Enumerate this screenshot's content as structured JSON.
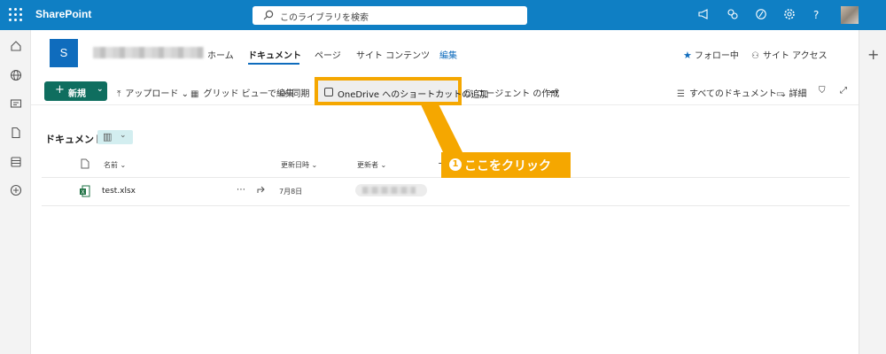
{
  "suitebar": {
    "brand": "SharePoint",
    "search_placeholder": "このライブラリを検索",
    "help": "?"
  },
  "site": {
    "logo_letter": "S",
    "nav": [
      "ホーム",
      "ドキュメント",
      "ページ",
      "サイト コンテンツ",
      "編集"
    ],
    "follow": "フォロー中",
    "access": "サイト アクセス"
  },
  "commandbar": {
    "new": "新規",
    "upload": "アップロード",
    "grid_edit": "グリッド ビューで編集",
    "sync": "同期",
    "onedrive_shortcut": "OneDrive へのショートカットの追加",
    "create_agent": "エージェント の作成",
    "more": "…",
    "all_docs": "すべてのドキュメント",
    "details": "詳細"
  },
  "library": {
    "title": "ドキュメント",
    "columns": {
      "name": "名前",
      "modified": "更新日時",
      "modified_by": "更新者"
    },
    "rows": [
      {
        "name": "test.xlsx",
        "modified": "7月8日"
      }
    ]
  },
  "callout": {
    "number": "1",
    "text": "ここをクリック"
  },
  "colors": {
    "suitebar": "#0f7fc4",
    "accent": "#0f6cbd",
    "new_button": "#0f6e5f",
    "highlight": "#f5a700"
  }
}
